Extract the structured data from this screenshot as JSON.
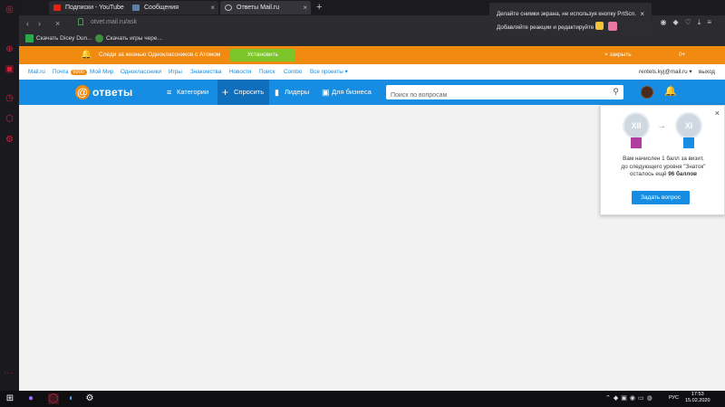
{
  "browser": {
    "tabs": [
      {
        "title": "Подписки - YouTube",
        "favicon_color": "#e62117"
      },
      {
        "title": "Сообщения",
        "favicon_color": "#5b7fa6"
      },
      {
        "title": "Ответы Mail.ru",
        "favicon_color": "#bbbbbb"
      }
    ],
    "url": "otvet.mail.ru/ask",
    "bookmarks": [
      {
        "label": "Скачать Dicey Dun...",
        "color": "#2aa84a"
      },
      {
        "label": "Скачать игры чере...",
        "color": "#3d8f3d"
      }
    ],
    "new_tab": "+"
  },
  "notification": {
    "line1": "Делайте снимки экрана, не используя кнопку PrtScn.",
    "line2": "Добавляйте реакции и редактируйте",
    "close": "×"
  },
  "promo": {
    "text": "Следи за жизнью Одноклассников с Атомом",
    "install_label": "Установить",
    "close_label": "× закрыть",
    "counter": "0+"
  },
  "portal": {
    "links": [
      {
        "label": "Mail.ru"
      },
      {
        "label": "Почта",
        "badge": "6000"
      },
      {
        "label": "Мой Мир"
      },
      {
        "label": "Одноклассники"
      },
      {
        "label": "Игры"
      },
      {
        "label": "Знакомства"
      },
      {
        "label": "Новости"
      },
      {
        "label": "Поиск"
      },
      {
        "label": "Combo"
      },
      {
        "label": "Все проекты ▾"
      }
    ],
    "user": "rentels.kyj@mail.ru ▾",
    "exit": "выход"
  },
  "header": {
    "logo_symbol": "@",
    "logo_text": "ответы",
    "nav": [
      {
        "label": "Категории",
        "icon": "≡"
      },
      {
        "label": "Спросить",
        "icon": "+"
      },
      {
        "label": "Лидеры",
        "icon": "▮"
      },
      {
        "label": "Для бизнеса",
        "icon": "▣"
      }
    ],
    "search_placeholder": "Поиск по вопросам"
  },
  "popup": {
    "from_level": "XII",
    "to_level": "XI",
    "text_line1": "Вам начислен 1 балл за визит,",
    "text_line2": "до следующего уровня \"Знаток\"",
    "text_line3_prefix": "осталось ещё",
    "points": "96 баллов",
    "button": "Задать вопрос"
  },
  "taskbar": {
    "time": "17:53",
    "date": "15.02.2020",
    "lang": "РУС"
  },
  "colors": {
    "accent_blue": "#168de2",
    "promo_orange": "#f08a10",
    "install_green": "#7cc52a",
    "opera_red": "#d2203c"
  }
}
